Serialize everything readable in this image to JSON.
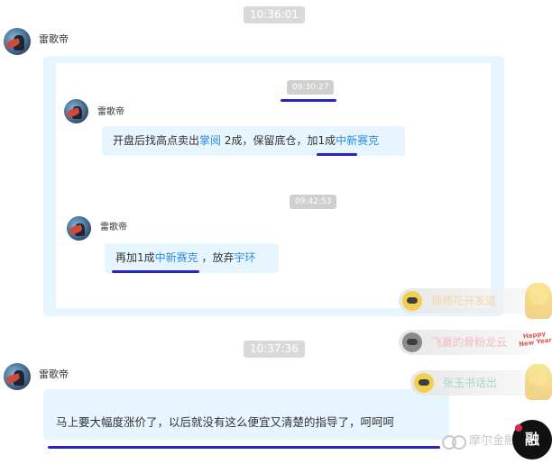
{
  "chat": {
    "timestamp1": "10:36:01",
    "timestamp2": "10:37:36",
    "sender": "雷歌帝",
    "forwarded": {
      "time1": "09:30:27",
      "time2": "09:42:53",
      "sender": "雷歌帝",
      "msg1": {
        "before": "开盘后找高点卖出",
        "stock_a": "掌阅",
        "middle": " 2成，保留底仓，加1成",
        "stock_b": "中新赛克"
      },
      "msg2": {
        "before": "再加1成",
        "stock_a": "中新赛克",
        "middle": " ，放弃",
        "stock_b": "宇环"
      }
    },
    "msg3": "马上要大幅度涨价了，以后就没有这么便宜又清楚的指导了，呵呵呵"
  },
  "gifts": [
    {
      "name": "柳师花开发道",
      "icon": "gift-icon-gold"
    },
    {
      "name": "飞赢的骨粉龙云",
      "icon": "gift-icon-gray"
    },
    {
      "name": "张玉书话出",
      "icon": "gift-icon-gold"
    }
  ],
  "decorations": {
    "new_year_text": "Happy New Year"
  },
  "watermark": {
    "brand": "摩尔金融",
    "badge": "融"
  },
  "colors": {
    "bubble": "#e6f5fe",
    "stock_link": "#2d8de0",
    "underline": "#2623c8"
  }
}
